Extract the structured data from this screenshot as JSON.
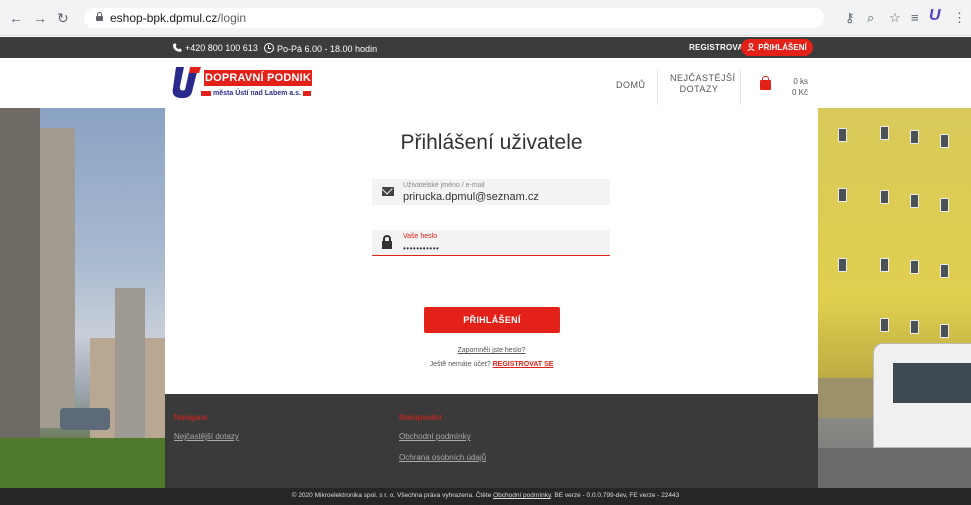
{
  "browser": {
    "url_host": "eshop-bpk.dpmul.cz",
    "url_path": "/login",
    "back_icon": "arrow-left-icon",
    "forward_icon": "arrow-right-icon",
    "reload_icon": "reload-icon"
  },
  "topbar": {
    "phone": "+420 800 100 613",
    "hours": "Po-Pá 6.00 - 18.00 hodin",
    "register": "REGISTROVAT",
    "login": "PŘIHLÁŠENÍ"
  },
  "header": {
    "logo_title": "DOPRAVNÍ PODNIK",
    "logo_subtitle": "města Ústí nad Labem a.s.",
    "nav_home": "DOMŮ",
    "nav_faq_line1": "NEJČASTĚJŠÍ",
    "nav_faq_line2": "DOTAZY",
    "cart_count": "0 ks",
    "cart_total": "0 Kč"
  },
  "login": {
    "title": "Přihlášení uživatele",
    "username_label": "Uživatelské jméno / e-mail",
    "username_value": "prirucka.dpmul@seznam.cz",
    "password_label": "Vaše heslo",
    "password_value": "•••••••••••",
    "submit": "PŘIHLÁŠENÍ",
    "forgot": "Zapomněli jste heslo?",
    "no_account": "Ještě nemáte účet?",
    "register_link": "REGISTROVAT SE"
  },
  "footer": {
    "nav_heading": "Navigace",
    "nav_faq": "Nejčastější dotazy",
    "shop_heading": "Nakupování",
    "terms": "Obchodní podmínky",
    "privacy": "Ochrana osobních údajů",
    "copyright_prefix": "© 2020 Mikroelektronika spol. s r. o. Všechna práva vyhrazena. Čtěte",
    "copyright_link": "Obchodní podmínky",
    "copyright_suffix": ". BE verze - 0.0.0.799-dev, FE verze - 22443"
  },
  "colors": {
    "accent": "#e32119",
    "dark_bar": "#3c3c3c",
    "footer": "#3a3a3a"
  }
}
